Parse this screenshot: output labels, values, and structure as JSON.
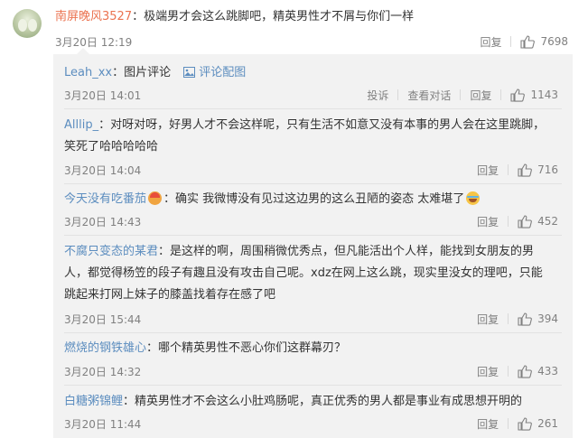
{
  "top_comment": {
    "username": "南屏晚风3527",
    "colon": "：",
    "text": "极端男才会这么跳脚吧，精英男性才不屑与你们一样",
    "time": "3月20日 12:19",
    "reply_label": "回复",
    "likes": "7698"
  },
  "reply_header": {
    "username": "Leah_xx",
    "colon": "：",
    "text": "图片评论",
    "view_image_label": "评论配图",
    "time": "3月20日 14:01",
    "report_label": "投诉",
    "view_conversation_label": "查看对话",
    "reply_label": "回复",
    "likes": "1143"
  },
  "replies": [
    {
      "username": "Alllip_",
      "colon": "：",
      "line1": "对呀对呀，好男人才不会这样呢，只有生活不如意又没有本事的男人会在这里跳脚，",
      "line2": "笑死了哈哈哈哈哈",
      "time": "3月20日 14:04",
      "reply_label": "回复",
      "likes": "716"
    },
    {
      "username": "今天没有吃番茄",
      "colon": "：",
      "line1": "确实 我微博没有见过这边男的这么丑陋的姿态 太难堪了",
      "time": "3月20日 14:43",
      "reply_label": "回复",
      "likes": "452"
    },
    {
      "username": "不腐只变态的某君",
      "colon": "：",
      "line1": "是这样的啊，周围稍微优秀点，但凡能活出个人样，能找到女朋友的男",
      "line2": "人，都觉得杨笠的段子有趣且没有攻击自己呢。xdz在网上这么跳，现实里没女的理吧，只能",
      "line3": "跳起来打网上妹子的膝盖找着存在感了吧",
      "time": "3月20日 15:44",
      "reply_label": "回复",
      "likes": "394"
    },
    {
      "username": "燃烧的钢铁雄心",
      "colon": "：",
      "line1": "哪个精英男性不恶心你们这群幕刃？",
      "time": "3月20日 14:32",
      "reply_label": "回复",
      "likes": "433"
    },
    {
      "username": "白糖粥锦鲤",
      "colon": "：",
      "line1": "精英男性才不会这么小肚鸡肠呢，真正优秀的男人都是事业有成思想开明的",
      "time": "3月20日 11:44",
      "reply_label": "回复",
      "likes": "261"
    }
  ],
  "icons": {
    "like": "thumbs-up-icon",
    "image": "image-icon",
    "avatar": "avatar-image"
  }
}
